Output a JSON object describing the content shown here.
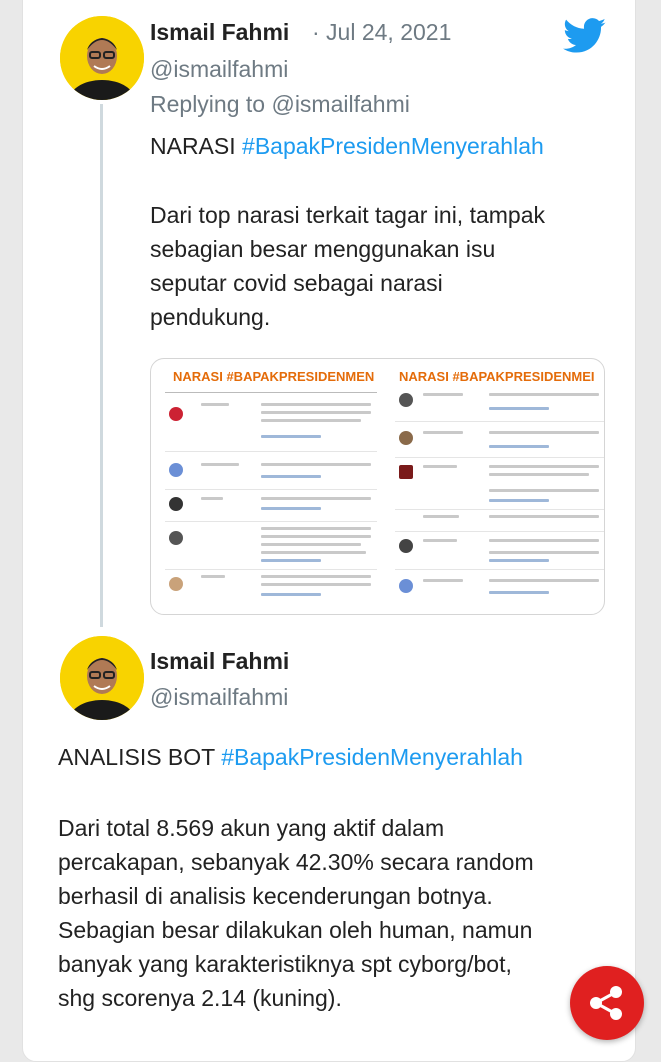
{
  "tweet1": {
    "author_name": "Ismail Fahmi",
    "date": "· Jul 24, 2021",
    "handle": "@ismailfahmi",
    "replying_to_prefix": "Replying to ",
    "replying_to_handle": "@ismailfahmi",
    "text_line1_prefix": "NARASI ",
    "text_line1_hashtag": "#BapakPresidenMenyerahlah",
    "paragraph_lines": [
      "Dari top narasi terkait tagar ini, tampak",
      "sebagian besar menggunakan isu",
      "seputar covid sebagai narasi",
      "pendukung."
    ],
    "media": {
      "left_title": "NARASI #BAPAKPRESIDENMEN",
      "right_title": "NARASI #BAPAKPRESIDENMEI"
    }
  },
  "tweet2": {
    "author_name": "Ismail Fahmi",
    "handle": "@ismailfahmi",
    "text_line1_prefix": "ANALISIS BOT ",
    "text_line1_hashtag": "#BapakPresidenMenyerahlah",
    "paragraph_lines": [
      "Dari total 8.569 akun yang aktif dalam",
      "percakapan, sebanyak 42.30% secara random",
      "berhasil di analisis kecenderungan botnya.",
      "Sebagian besar dilakukan oleh human, namun",
      "banyak yang karakteristiknya spt cyborg/bot,",
      "shg scorenya 2.14 (kuning)."
    ]
  },
  "icons": {
    "brand": "twitter-bird-icon",
    "share": "share-icon"
  },
  "colors": {
    "hashtag": "#1d9bf0",
    "twitter": "#1d9bf0",
    "share_button": "#e02020",
    "media_title": "#e46c0a"
  }
}
